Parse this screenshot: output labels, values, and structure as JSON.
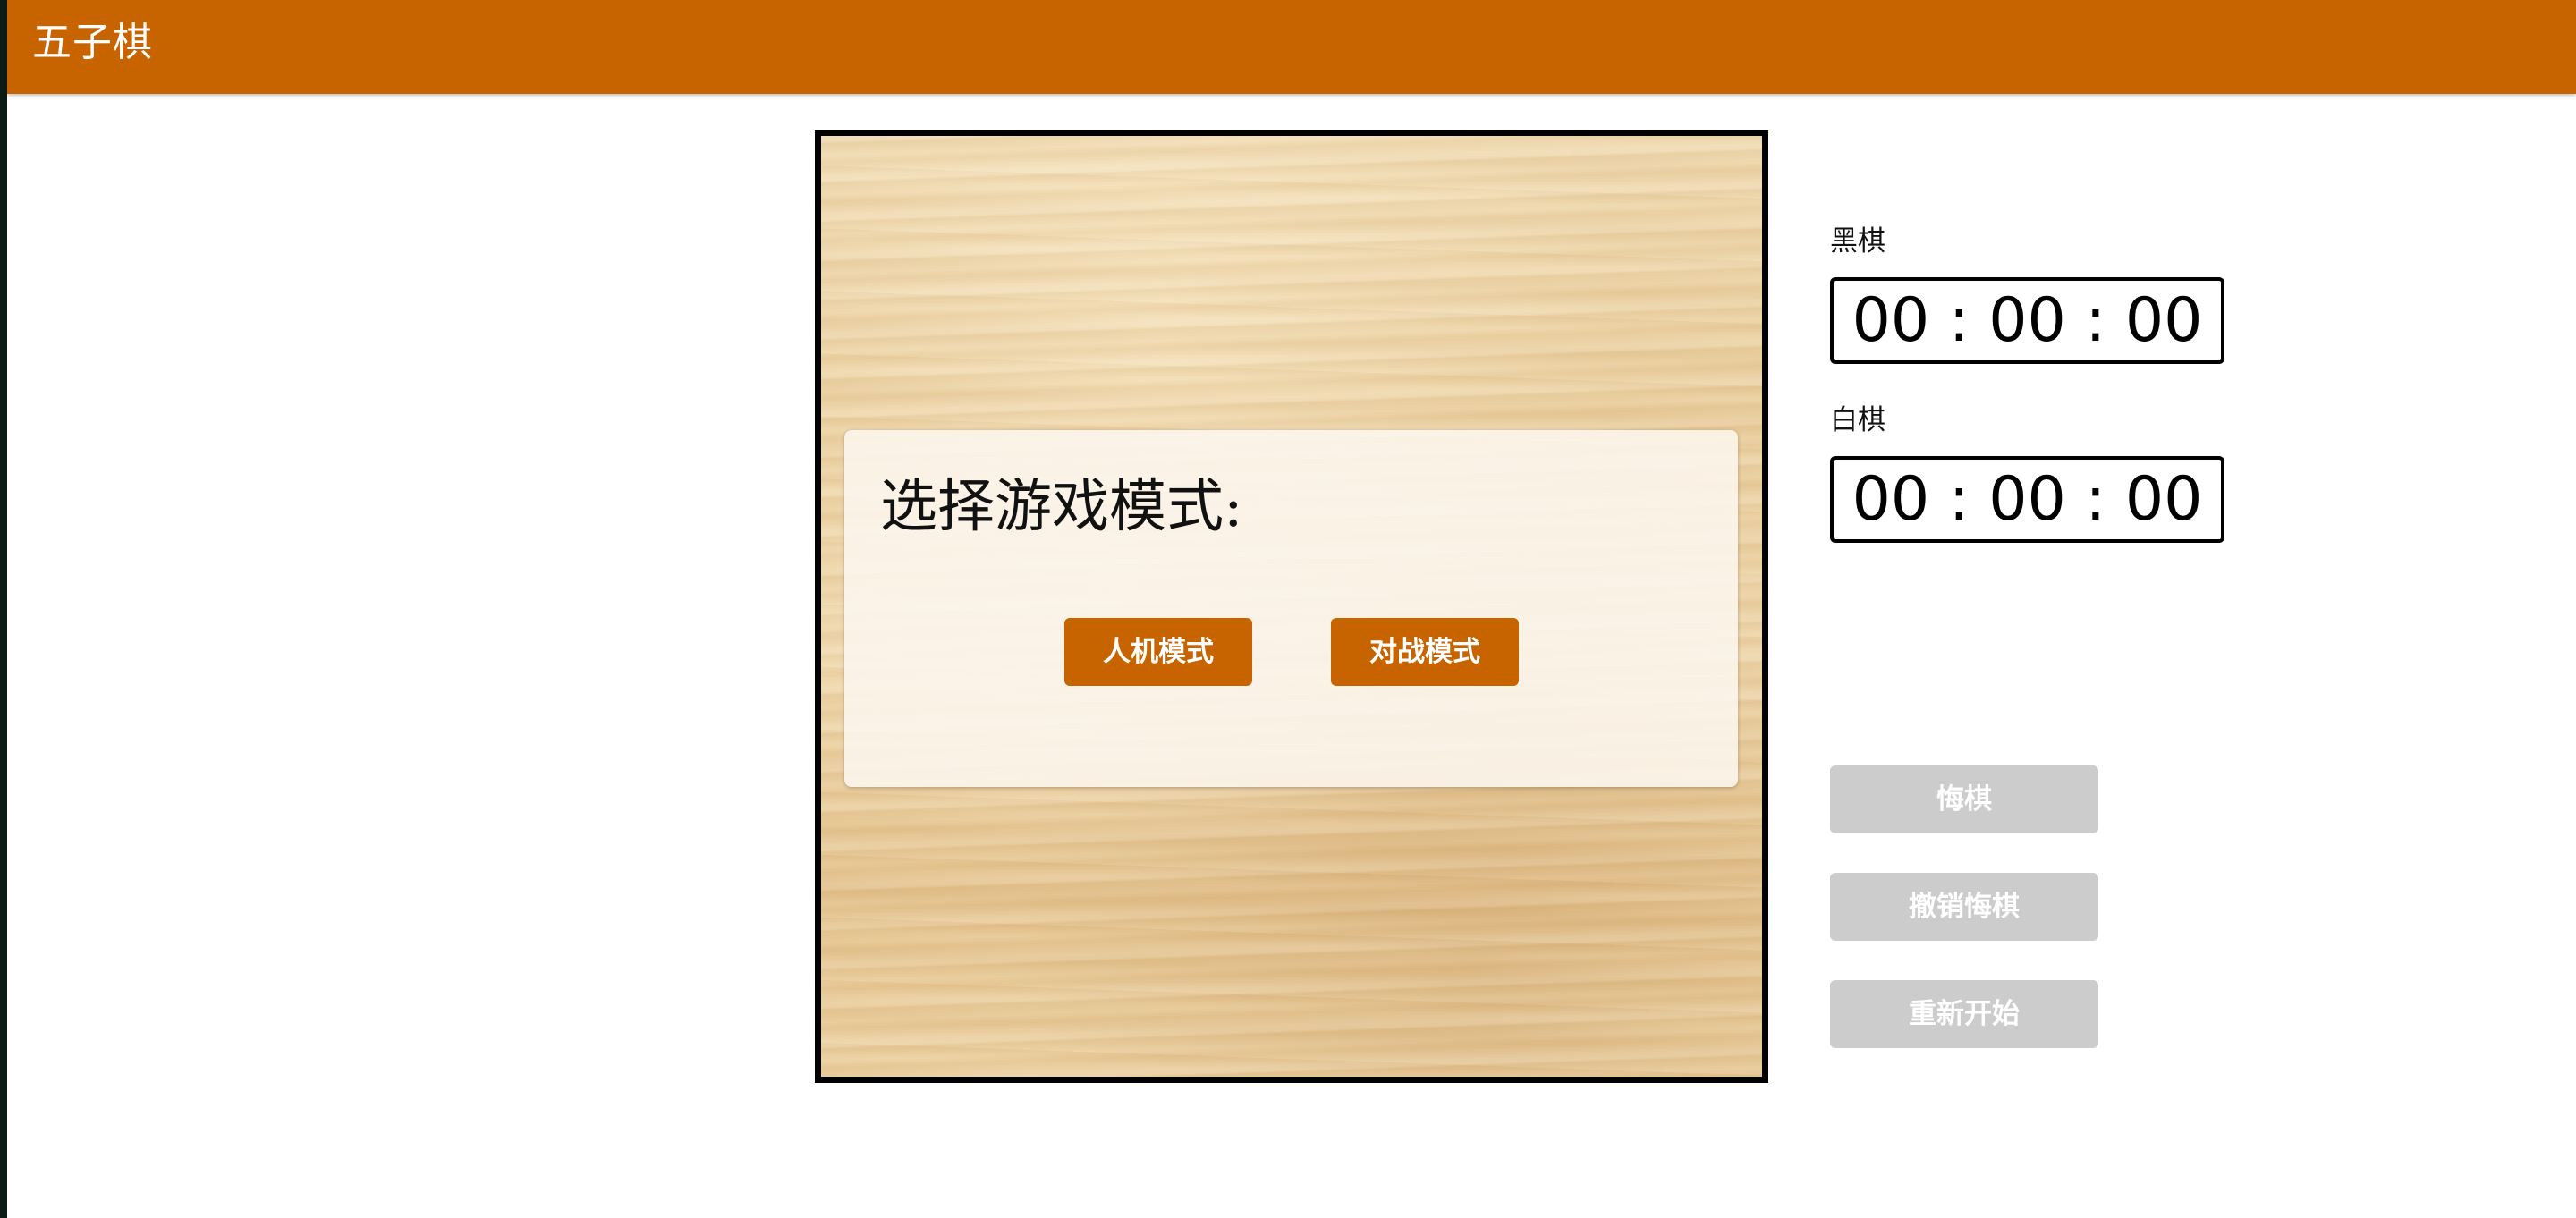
{
  "app": {
    "title": "五子棋"
  },
  "colors": {
    "header_bg": "#c86400",
    "primary_button": "#c86400",
    "disabled_button": "#cccccc"
  },
  "mode_dialog": {
    "title": "选择游戏模式:",
    "buttons": {
      "ai_mode": "人机模式",
      "pvp_mode": "对战模式"
    }
  },
  "timers": {
    "black": {
      "label": "黑棋",
      "value": "00 : 00 : 00"
    },
    "white": {
      "label": "白棋",
      "value": "00 : 00 : 00"
    }
  },
  "controls": {
    "undo": "悔棋",
    "cancel_undo": "撤销悔棋",
    "restart": "重新开始"
  }
}
